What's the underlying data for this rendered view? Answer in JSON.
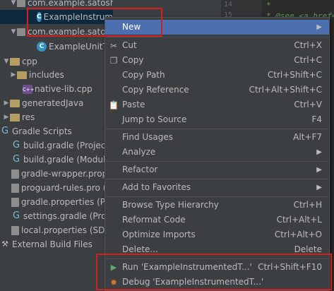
{
  "project_tree": {
    "items": [
      {
        "label": "com.example.satoshi_maemoto.myapplication (an",
        "icon": "package-icon"
      },
      {
        "label": "ExampleInstrumentedTest",
        "icon": "class-icon"
      },
      {
        "label": "com.example.satosl",
        "icon": "package-icon"
      },
      {
        "label": "ExampleUnitTes",
        "icon": "class-icon"
      },
      {
        "label": "cpp",
        "icon": "folder-icon"
      },
      {
        "label": "includes",
        "icon": "folder-icon"
      },
      {
        "label": "native-lib.cpp",
        "icon": "cpp-file-icon"
      },
      {
        "label": "generatedJava",
        "icon": "folder-icon"
      },
      {
        "label": "res",
        "icon": "folder-icon"
      },
      {
        "label": "Gradle Scripts",
        "icon": "gradle-icon"
      },
      {
        "label": "build.gradle (Project: C",
        "icon": "gradle-icon"
      },
      {
        "label": "build.gradle (Module:",
        "icon": "gradle-icon"
      },
      {
        "label": "gradle-wrapper.prope",
        "icon": "file-icon"
      },
      {
        "label": "proguard-rules.pro (Pr",
        "icon": "file-icon"
      },
      {
        "label": "gradle.properties (Proj",
        "icon": "file-icon"
      },
      {
        "label": "settings.gradle (Projec",
        "icon": "gradle-icon"
      },
      {
        "label": "local.properties (SDK L",
        "icon": "file-icon"
      },
      {
        "label": "External Build Files",
        "icon": "external-build-icon"
      }
    ]
  },
  "editor": {
    "line_numbers": [
      "14",
      "15"
    ],
    "code_lines": [
      "*",
      "* @see <a href=\""
    ]
  },
  "context_menu": {
    "items": [
      {
        "label": "New",
        "shortcut": "",
        "submenu": true,
        "icon": ""
      },
      {
        "label": "Cut",
        "shortcut": "Ctrl+X",
        "icon": "cut-icon"
      },
      {
        "label": "Copy",
        "shortcut": "Ctrl+C",
        "icon": "copy-icon"
      },
      {
        "label": "Copy Path",
        "shortcut": "Ctrl+Shift+C",
        "icon": ""
      },
      {
        "label": "Copy Reference",
        "shortcut": "Ctrl+Alt+Shift+C",
        "icon": ""
      },
      {
        "label": "Paste",
        "shortcut": "Ctrl+V",
        "icon": "paste-icon"
      },
      {
        "label": "Jump to Source",
        "shortcut": "F4",
        "icon": ""
      },
      {
        "label": "Find Usages",
        "shortcut": "Alt+F7",
        "icon": ""
      },
      {
        "label": "Analyze",
        "shortcut": "",
        "submenu": true,
        "icon": ""
      },
      {
        "label": "Refactor",
        "shortcut": "",
        "submenu": true,
        "icon": ""
      },
      {
        "label": "Add to Favorites",
        "shortcut": "",
        "submenu": true,
        "icon": ""
      },
      {
        "label": "Browse Type Hierarchy",
        "shortcut": "Ctrl+H",
        "icon": ""
      },
      {
        "label": "Reformat Code",
        "shortcut": "Ctrl+Alt+L",
        "icon": ""
      },
      {
        "label": "Optimize Imports",
        "shortcut": "Ctrl+Alt+O",
        "icon": ""
      },
      {
        "label": "Delete...",
        "shortcut": "Delete",
        "icon": ""
      },
      {
        "label": "Run 'ExampleInstrumentedT...'",
        "shortcut": "Ctrl+Shift+F10",
        "icon": "run-icon"
      },
      {
        "label": "Debug 'ExampleInstrumentedT...'",
        "shortcut": "",
        "icon": "debug-icon"
      }
    ]
  },
  "colors": {
    "highlight_box": "#d0201f",
    "menu_hover": "#4b6eaf",
    "menu_bg": "#3c3f41"
  }
}
